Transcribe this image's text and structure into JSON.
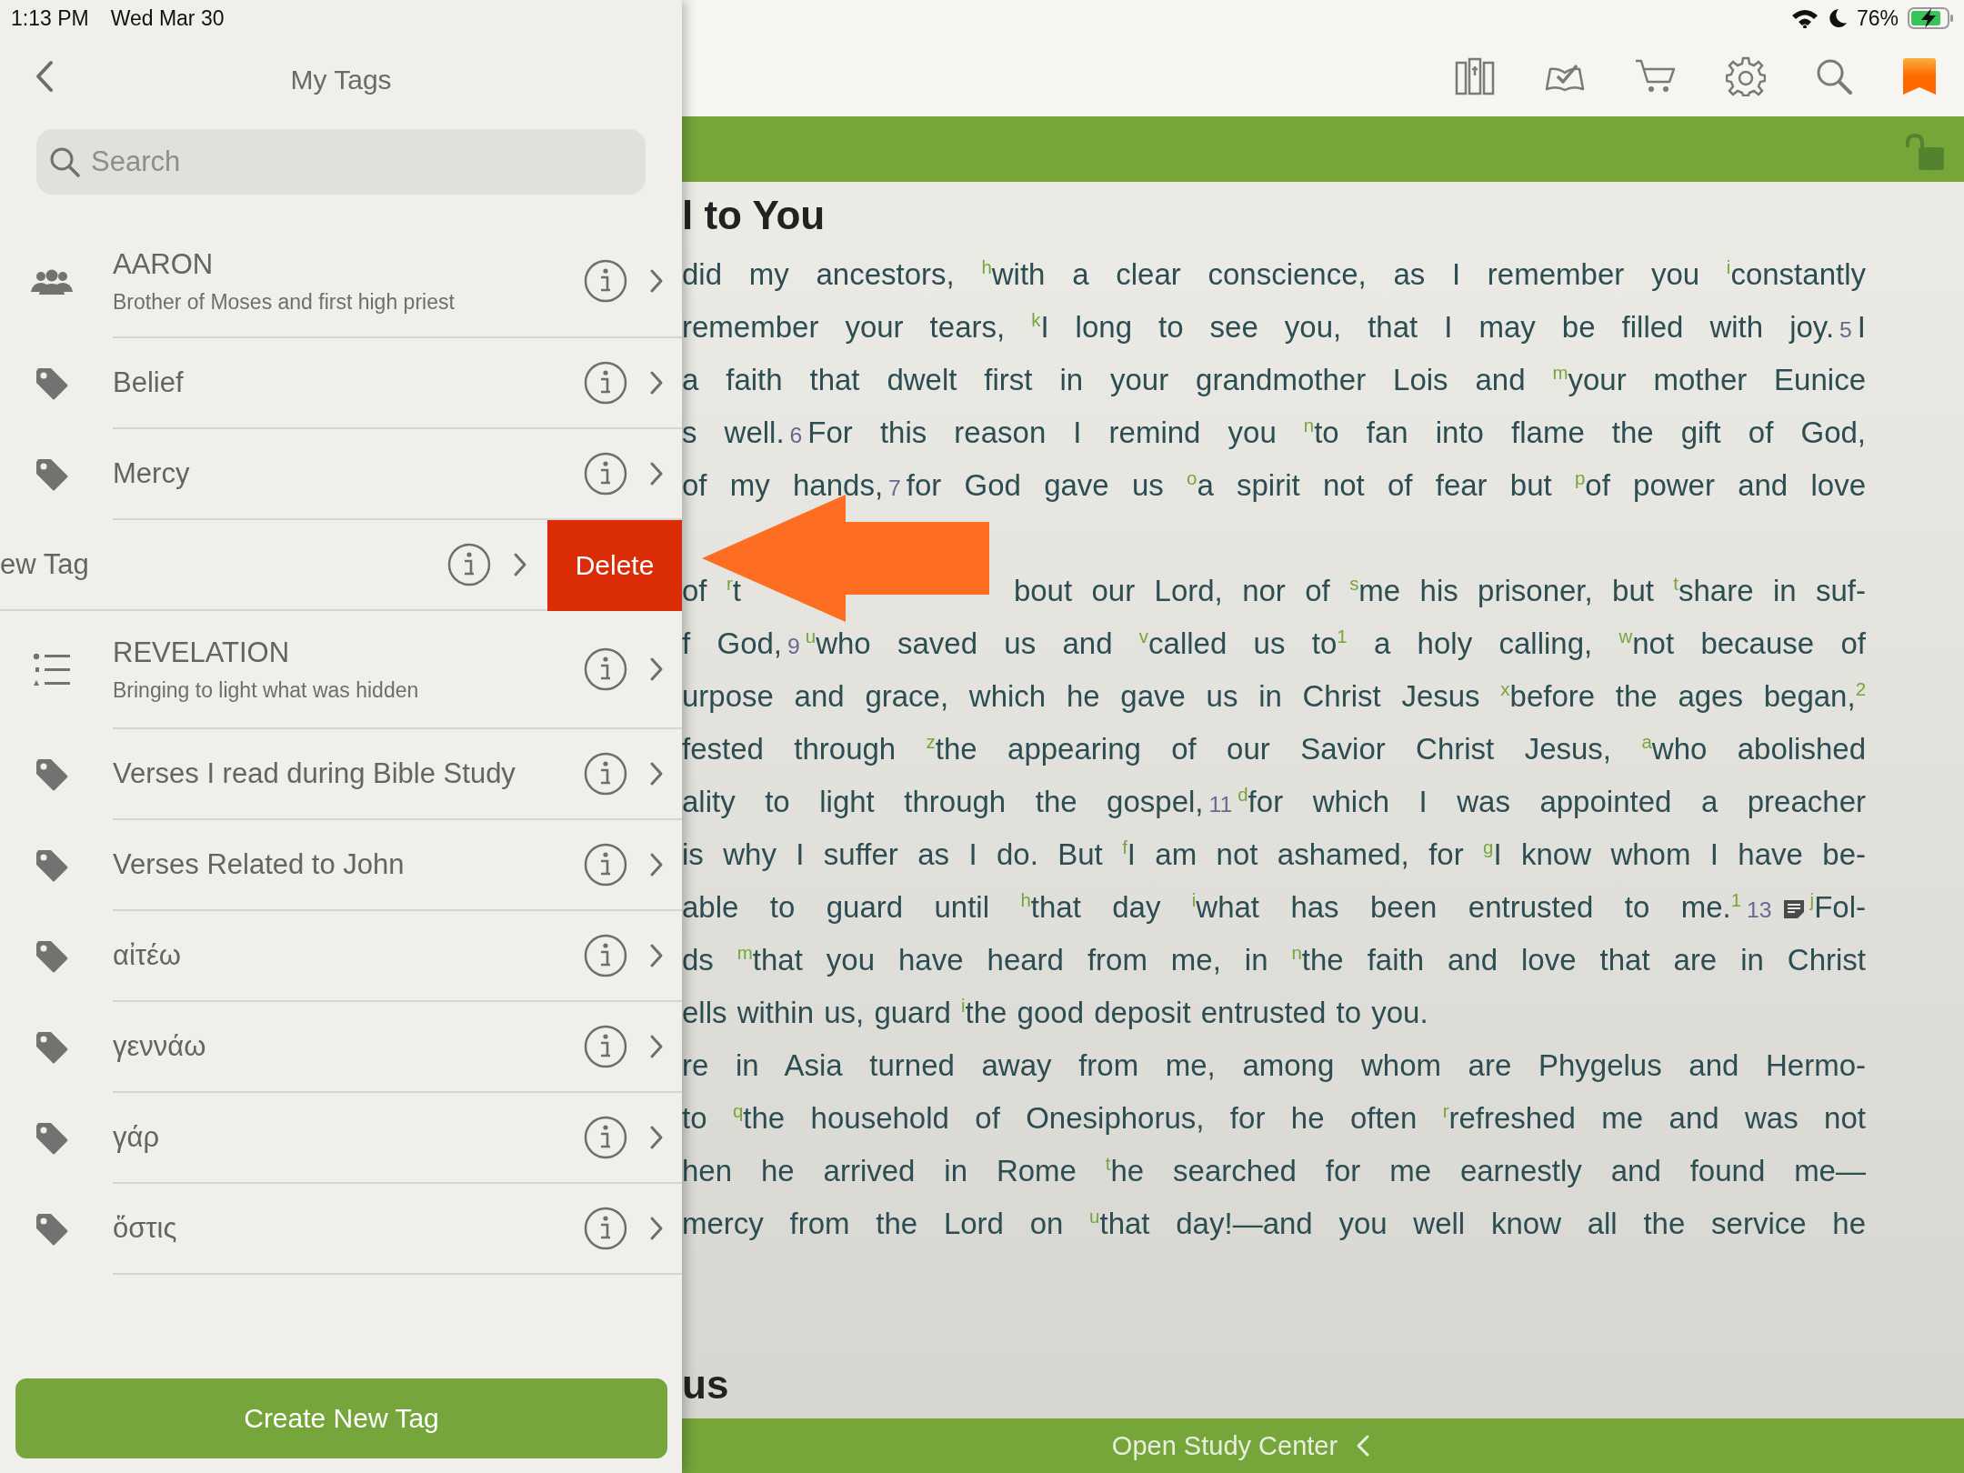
{
  "status_bar": {
    "time": "1:13 PM",
    "date": "Wed Mar 30",
    "battery": "76%"
  },
  "panel": {
    "title": "My Tags",
    "search": {
      "placeholder": "Search"
    },
    "tags": [
      {
        "kind": "people",
        "name": "AARON",
        "description": "Brother of Moses and first high priest",
        "swiped": false
      },
      {
        "kind": "tag",
        "name": "Belief",
        "swiped": false
      },
      {
        "kind": "tag",
        "name": "Mercy",
        "swiped": false
      },
      {
        "name": "ew Tag",
        "swiped": true,
        "action": "Delete"
      },
      {
        "kind": "list",
        "name": "REVELATION",
        "description": "Bringing to light what was hidden",
        "swiped": false
      },
      {
        "kind": "tag",
        "name": "Verses I read during Bible Study",
        "swiped": false
      },
      {
        "kind": "tag",
        "name": "Verses Related to John",
        "swiped": false
      },
      {
        "kind": "tag",
        "name": "αἰτέω",
        "swiped": false
      },
      {
        "kind": "tag",
        "name": "γεννάω",
        "swiped": false
      },
      {
        "kind": "tag",
        "name": "γάρ",
        "swiped": false
      },
      {
        "kind": "tag",
        "name": "ὅστις",
        "swiped": false
      }
    ],
    "create_button": "Create New Tag"
  },
  "reader": {
    "heading": "l to You",
    "lines": [
      {
        "justified": true,
        "segments": [
          {
            "kind": "text",
            "text": "did my ancestors, $^{h}$with a clear conscience, as I remember you $^{i}$constantly"
          }
        ]
      },
      {
        "justified": true,
        "segments": [
          {
            "kind": "text",
            "text": "remember your tears, $^{k}$I long to see you, that I may be filled with joy."
          },
          {
            "kind": "verse",
            "text": "5"
          },
          {
            "kind": "text",
            "text": "I"
          }
        ]
      },
      {
        "justified": true,
        "segments": [
          {
            "kind": "text",
            "text": "a faith that dwelt first in your grandmother Lois and $^{m}$your mother Eunice"
          }
        ]
      },
      {
        "justified": true,
        "segments": [
          {
            "kind": "text",
            "text": "s well."
          },
          {
            "kind": "verse",
            "text": "6"
          },
          {
            "kind": "text",
            "text": "For this reason I remind you $^{n}$to fan into flame the gift of God,"
          }
        ]
      },
      {
        "justified": true,
        "segments": [
          {
            "kind": "text",
            "text": "of my hands,"
          },
          {
            "kind": "verse",
            "text": "7"
          },
          {
            "kind": "text",
            "text": "for God gave us $^{o}$a spirit not of fear but $^{p}$of power and love"
          }
        ]
      },
      {
        "segments": [
          {
            "kind": "hidden"
          }
        ]
      },
      {
        "justified": true,
        "segments": [
          {
            "kind": "text",
            "text": "of $^{r}$t"
          },
          {
            "kind": "hidden"
          },
          {
            "kind": "text",
            "text": "bout our Lord, nor of $^{s}$me his prisoner, but $^{t}$share in suf-"
          }
        ]
      },
      {
        "justified": true,
        "segments": [
          {
            "kind": "text",
            "text": "f God,"
          },
          {
            "kind": "verse",
            "text": "9"
          },
          {
            "kind": "text",
            "text": "$^{u}$who saved us and $^{v}$called us to$^{1}$ a holy calling, $^{w}$not because of"
          }
        ]
      },
      {
        "justified": true,
        "segments": [
          {
            "kind": "text",
            "text": "urpose and grace, which he gave us in Christ Jesus $^{x}$before the ages began,$^{2}$"
          }
        ]
      },
      {
        "justified": true,
        "segments": [
          {
            "kind": "text",
            "text": "fested through $^{z}$the appearing of our Savior Christ Jesus, $^{a}$who abolished"
          }
        ]
      },
      {
        "justified": true,
        "segments": [
          {
            "kind": "text",
            "text": "ality to light through the gospel,"
          },
          {
            "kind": "verse",
            "text": "11"
          },
          {
            "kind": "text",
            "text": "$^{d}$for which I was appointed a preacher"
          }
        ]
      },
      {
        "justified": true,
        "segments": [
          {
            "kind": "text",
            "text": "is why I suffer as I do. But $^{f}$I am not ashamed, for $^{g}$I know whom I have be-"
          }
        ]
      },
      {
        "justified": true,
        "segments": [
          {
            "kind": "text",
            "text": "able to guard until $^{h}$that day $^{i}$what has been entrusted to me.$^{1}$"
          },
          {
            "kind": "verse",
            "text": "13"
          },
          {
            "kind": "note"
          },
          {
            "kind": "text",
            "text": "$^{j}$Fol-"
          }
        ]
      },
      {
        "justified": true,
        "segments": [
          {
            "kind": "text",
            "text": "ds $^{m}$that you have heard from me, in $^{n}$the faith and love that are in Christ"
          }
        ]
      },
      {
        "justified": false,
        "segments": [
          {
            "kind": "text",
            "text": "ells within us, guard $^{i}$the good deposit entrusted to you."
          }
        ]
      },
      {
        "justified": true,
        "segments": [
          {
            "kind": "text",
            "text": "re in Asia turned away from me, among whom are Phygelus and Hermo-"
          }
        ]
      },
      {
        "justified": true,
        "segments": [
          {
            "kind": "text",
            "text": "to $^{q}$the household of Onesiphorus, for he often $^{r}$refreshed me and was not"
          }
        ]
      },
      {
        "justified": true,
        "segments": [
          {
            "kind": "text",
            "text": "hen he arrived in Rome $^{t}$he searched for me earnestly and found me—"
          }
        ]
      },
      {
        "justified": true,
        "segments": [
          {
            "kind": "text",
            "text": "mercy from the Lord on $^{u}$that day!—and you well know all the service he"
          }
        ]
      }
    ],
    "next_heading": "us"
  },
  "bottom_bar": {
    "label": "Open Study Center"
  }
}
